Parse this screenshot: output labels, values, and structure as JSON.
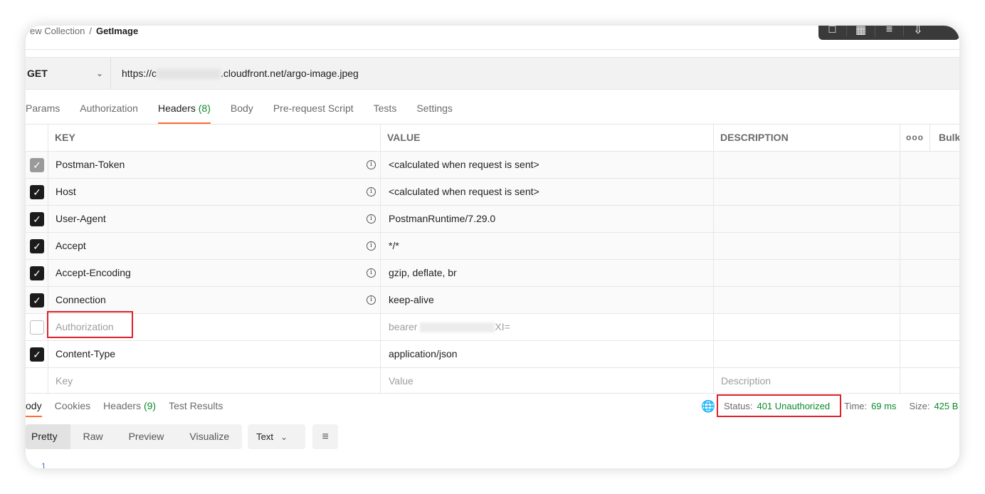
{
  "breadcrumb": {
    "collection": "ew Collection",
    "separator": "/",
    "request": "GetImage"
  },
  "request": {
    "method": "GET",
    "url_prefix": "https://c",
    "url_suffix": ".cloudfront.net/argo-image.jpeg"
  },
  "request_tabs": [
    {
      "label": "Params"
    },
    {
      "label": "Authorization"
    },
    {
      "label": "Headers",
      "count": "(8)"
    },
    {
      "label": "Body"
    },
    {
      "label": "Pre-request Script"
    },
    {
      "label": "Tests"
    },
    {
      "label": "Settings"
    }
  ],
  "headers_table": {
    "columns": {
      "key": "KEY",
      "value": "VALUE",
      "description": "DESCRIPTION",
      "more": "ooo",
      "bulk": "Bulk"
    },
    "rows": [
      {
        "key": "Postman-Token",
        "value": "<calculated when request is sent>",
        "checked": "gray"
      },
      {
        "key": "Host",
        "value": "<calculated when request is sent>",
        "checked": "true"
      },
      {
        "key": "User-Agent",
        "value": "PostmanRuntime/7.29.0",
        "checked": "true"
      },
      {
        "key": "Accept",
        "value": "*/*",
        "checked": "true"
      },
      {
        "key": "Accept-Encoding",
        "value": "gzip, deflate, br",
        "checked": "true"
      },
      {
        "key": "Connection",
        "value": "keep-alive",
        "checked": "true"
      },
      {
        "key": "Authorization",
        "value_prefix": "bearer",
        "value_suffix": "XI=",
        "checked": "false"
      },
      {
        "key": "Content-Type",
        "value": "application/json",
        "checked": "true"
      }
    ],
    "placeholders": {
      "key": "Key",
      "value": "Value",
      "description": "Description"
    }
  },
  "response": {
    "tabs": [
      {
        "label": "ody"
      },
      {
        "label": "Cookies"
      },
      {
        "label": "Headers",
        "count": "(9)"
      },
      {
        "label": "Test Results"
      }
    ],
    "status_label": "Status:",
    "status_value": "401 Unauthorized",
    "time_label": "Time:",
    "time_value": "69 ms",
    "size_label": "Size:",
    "size_value": "425 B"
  },
  "view": {
    "modes": [
      "Pretty",
      "Raw",
      "Preview",
      "Visualize"
    ],
    "format": "Text",
    "line_number": "1"
  },
  "colors": {
    "accent": "#ff6c37",
    "success": "#0c8a2e",
    "highlight": "#e0202a"
  }
}
